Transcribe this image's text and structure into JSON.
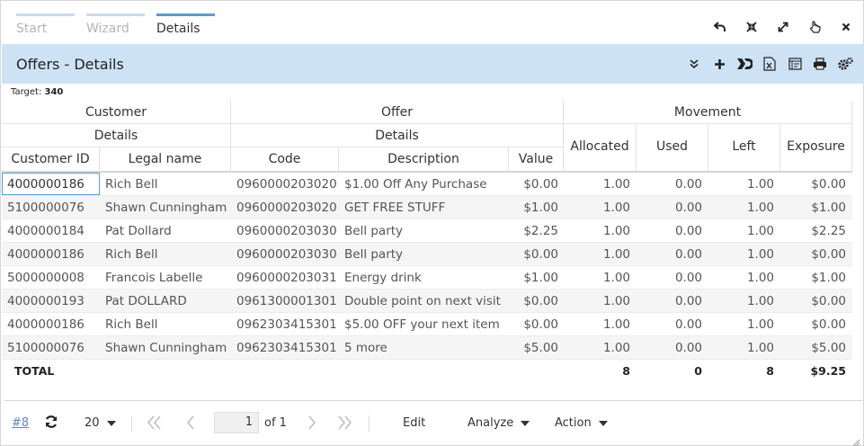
{
  "tabs": [
    "Start",
    "Wizard",
    "Details"
  ],
  "title": "Offers - Details",
  "target": {
    "label": "Target:",
    "value": "340"
  },
  "groups": {
    "customer": "Customer",
    "customer_details": "Details",
    "offer": "Offer",
    "offer_details": "Details",
    "movement": "Movement"
  },
  "columns": {
    "customer_id": "Customer ID",
    "legal_name": "Legal name",
    "code": "Code",
    "description": "Description",
    "value": "Value",
    "allocated": "Allocated",
    "used": "Used",
    "left": "Left",
    "exposure": "Exposure"
  },
  "rows": [
    [
      "4000000186",
      "Rich Bell",
      "0960000203020",
      "$1.00 Off Any Purchase",
      "$0.00",
      "1.00",
      "0.00",
      "1.00",
      "$0.00"
    ],
    [
      "5100000076",
      "Shawn Cunningham",
      "0960000203020",
      "GET FREE STUFF",
      "$1.00",
      "1.00",
      "0.00",
      "1.00",
      "$1.00"
    ],
    [
      "4000000184",
      "Pat Dollard",
      "0960000203030",
      "Bell party",
      "$2.25",
      "1.00",
      "0.00",
      "1.00",
      "$2.25"
    ],
    [
      "4000000186",
      "Rich Bell",
      "0960000203030",
      "Bell party",
      "$0.00",
      "1.00",
      "0.00",
      "1.00",
      "$0.00"
    ],
    [
      "5000000008",
      "Francois Labelle",
      "0960000203031",
      "Energy drink",
      "$1.00",
      "1.00",
      "0.00",
      "1.00",
      "$1.00"
    ],
    [
      "4000000193",
      "Pat DOLLARD",
      "0961300001301",
      "Double point on next visit",
      "$0.00",
      "1.00",
      "0.00",
      "1.00",
      "$0.00"
    ],
    [
      "4000000186",
      "Rich Bell",
      "0962303415301",
      "$5.00 OFF your next item",
      "$0.00",
      "1.00",
      "0.00",
      "1.00",
      "$0.00"
    ],
    [
      "5100000076",
      "Shawn Cunningham",
      "0962303415301",
      "5 more",
      "$5.00",
      "1.00",
      "0.00",
      "1.00",
      "$5.00"
    ]
  ],
  "total": {
    "label": "TOTAL",
    "allocated": "8",
    "used": "0",
    "left": "8",
    "exposure": "$9.25"
  },
  "footer": {
    "count": "#8",
    "page_size": "20",
    "page": "1",
    "of": "of 1",
    "edit": "Edit",
    "analyze": "Analyze",
    "action": "Action"
  },
  "icons": {
    "window": [
      "undo-icon",
      "collapse-icon",
      "expand-icon",
      "pointer-icon",
      "close-icon"
    ],
    "toolbar": [
      "chevron-double-down-icon",
      "add-icon",
      "merge-icon",
      "excel-export-icon",
      "form-icon",
      "print-icon",
      "settings-icon"
    ]
  },
  "colors": {
    "accent": "#5b9bd5",
    "titlebar": "#cde2f4",
    "link": "#5b87c5"
  }
}
